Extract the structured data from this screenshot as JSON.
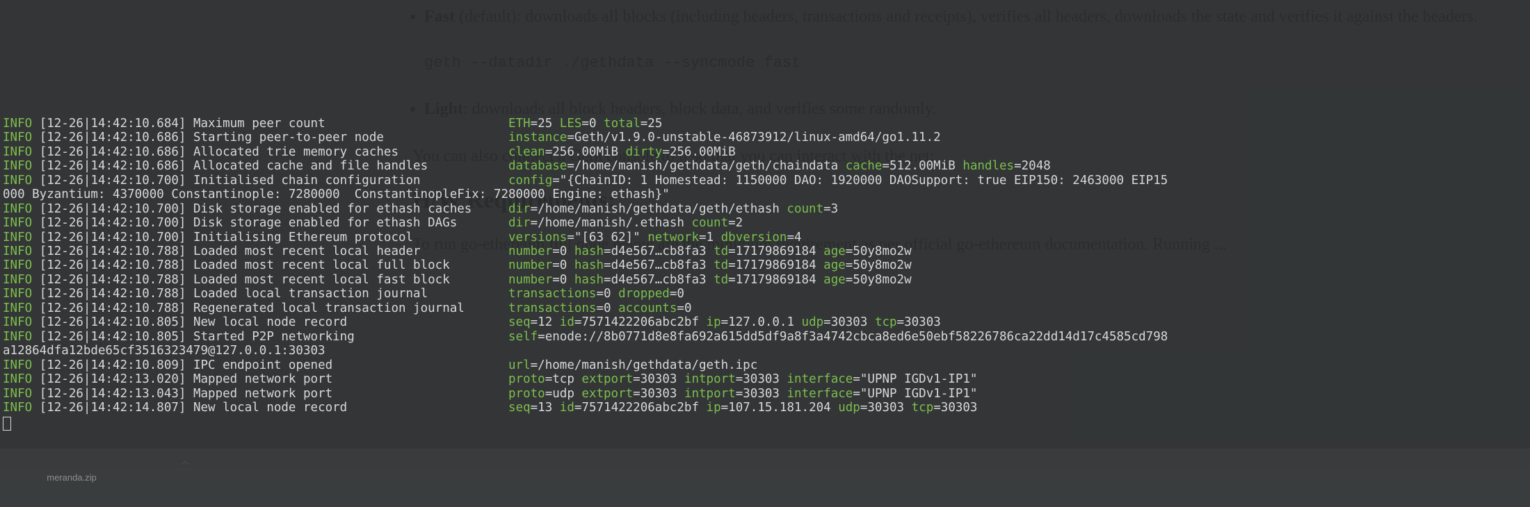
{
  "level": "INFO",
  "lines": [
    {
      "ts": "[12-26|14:42:10.684]",
      "msg": "Maximum peer count",
      "msg_pad": 43,
      "kv": [
        [
          "ETH",
          "25"
        ],
        [
          "LES",
          "0"
        ],
        [
          "total",
          "25"
        ]
      ]
    },
    {
      "ts": "[12-26|14:42:10.686]",
      "msg": "Starting peer-to-peer node",
      "msg_pad": 43,
      "kv": [
        [
          "instance",
          "Geth/v1.9.0-unstable-46873912/linux-amd64/go1.11.2"
        ]
      ]
    },
    {
      "ts": "[12-26|14:42:10.686]",
      "msg": "Allocated trie memory caches",
      "msg_pad": 43,
      "kv": [
        [
          "clean",
          "256.00MiB"
        ],
        [
          "dirty",
          "256.00MiB"
        ]
      ]
    },
    {
      "ts": "[12-26|14:42:10.686]",
      "msg": "Allocated cache and file handles",
      "msg_pad": 43,
      "kv": [
        [
          "database",
          "/home/manish/gethdata/geth/chaindata"
        ],
        [
          "cache",
          "512.00MiB"
        ],
        [
          "handles",
          "2048"
        ]
      ]
    },
    {
      "ts": "[12-26|14:42:10.700]",
      "msg": "Initialised chain configuration",
      "msg_pad": 43,
      "kv": [
        [
          "config",
          "\"{ChainID: 1 Homestead: 1150000 DAO: 1920000 DAOSupport: true EIP150: 2463000 EIP15"
        ]
      ],
      "wrap": "000 Byzantium: 4370000 Constantinople: 7280000  ConstantinopleFix: 7280000 Engine: ethash}\""
    },
    {
      "ts": "[12-26|14:42:10.700]",
      "msg": "Disk storage enabled for ethash caches",
      "msg_pad": 43,
      "kv": [
        [
          "dir",
          "/home/manish/gethdata/geth/ethash"
        ],
        [
          "count",
          "3"
        ]
      ]
    },
    {
      "ts": "[12-26|14:42:10.700]",
      "msg": "Disk storage enabled for ethash DAGs",
      "msg_pad": 43,
      "kv": [
        [
          "dir",
          "/home/manish/.ethash"
        ],
        [
          "count",
          "2"
        ]
      ],
      "kv_pad": {
        "1": 37
      }
    },
    {
      "ts": "[12-26|14:42:10.700]",
      "msg": "Initialising Ethereum protocol",
      "msg_pad": 43,
      "kv": [
        [
          "versions",
          "\"[63 62]\""
        ],
        [
          "network",
          "1"
        ],
        [
          "dbversion",
          "4"
        ]
      ]
    },
    {
      "ts": "[12-26|14:42:10.788]",
      "msg": "Loaded most recent local header",
      "msg_pad": 43,
      "kv": [
        [
          "number",
          "0"
        ],
        [
          "hash",
          "d4e567…cb8fa3"
        ],
        [
          "td",
          "17179869184"
        ],
        [
          "age",
          "50y8mo2w"
        ]
      ]
    },
    {
      "ts": "[12-26|14:42:10.788]",
      "msg": "Loaded most recent local full block",
      "msg_pad": 43,
      "kv": [
        [
          "number",
          "0"
        ],
        [
          "hash",
          "d4e567…cb8fa3"
        ],
        [
          "td",
          "17179869184"
        ],
        [
          "age",
          "50y8mo2w"
        ]
      ]
    },
    {
      "ts": "[12-26|14:42:10.788]",
      "msg": "Loaded most recent local fast block",
      "msg_pad": 43,
      "kv": [
        [
          "number",
          "0"
        ],
        [
          "hash",
          "d4e567…cb8fa3"
        ],
        [
          "td",
          "17179869184"
        ],
        [
          "age",
          "50y8mo2w"
        ]
      ]
    },
    {
      "ts": "[12-26|14:42:10.788]",
      "msg": "Loaded local transaction journal",
      "msg_pad": 43,
      "kv": [
        [
          "transactions",
          "0"
        ],
        [
          "dropped",
          "0"
        ]
      ]
    },
    {
      "ts": "[12-26|14:42:10.788]",
      "msg": "Regenerated local transaction journal",
      "msg_pad": 43,
      "kv": [
        [
          "transactions",
          "0"
        ],
        [
          "accounts",
          "0"
        ]
      ]
    },
    {
      "ts": "[12-26|14:42:10.805]",
      "msg": "New local node record",
      "msg_pad": 43,
      "kv": [
        [
          "seq",
          "12"
        ],
        [
          "id",
          "7571422206abc2bf"
        ],
        [
          "ip",
          "127.0.0.1"
        ],
        [
          "udp",
          "30303"
        ],
        [
          "tcp",
          "30303"
        ]
      ]
    },
    {
      "ts": "[12-26|14:42:10.805]",
      "msg": "Started P2P networking",
      "msg_pad": 43,
      "kv": [
        [
          "self",
          "enode://8b0771d8e8fa692a615dd5df9a8f3a4742cbca8ed6e50ebf58226786ca22dd14d17c4585cd798"
        ]
      ],
      "wrap": "a12864dfa12bde65cf3516323479@127.0.0.1:30303"
    },
    {
      "ts": "[12-26|14:42:10.809]",
      "msg": "IPC endpoint opened",
      "msg_pad": 43,
      "kv": [
        [
          "url",
          "/home/manish/gethdata/geth.ipc"
        ]
      ]
    },
    {
      "ts": "[12-26|14:42:13.020]",
      "msg": "Mapped network port",
      "msg_pad": 43,
      "kv": [
        [
          "proto",
          "tcp"
        ],
        [
          "extport",
          "30303"
        ],
        [
          "intport",
          "30303"
        ],
        [
          "interface",
          "\"UPNP IGDv1-IP1\""
        ]
      ]
    },
    {
      "ts": "[12-26|14:42:13.043]",
      "msg": "Mapped network port",
      "msg_pad": 43,
      "kv": [
        [
          "proto",
          "udp"
        ],
        [
          "extport",
          "30303"
        ],
        [
          "intport",
          "30303"
        ],
        [
          "interface",
          "\"UPNP IGDv1-IP1\""
        ]
      ]
    },
    {
      "ts": "[12-26|14:42:14.807]",
      "msg": "New local node record",
      "msg_pad": 43,
      "kv": [
        [
          "seq",
          "13"
        ],
        [
          "id",
          "7571422206abc2bf"
        ],
        [
          "ip",
          "107.15.181.204"
        ],
        [
          "udp",
          "30303"
        ],
        [
          "tcp",
          "30303"
        ]
      ]
    }
  ],
  "ghost": {
    "bullet1_b": "Fast",
    "bullet1_rest": " (default): downloads all blocks (including headers, transactions and receipts), verifies all headers, downloads the state and verifies it against the headers.",
    "code1": "geth --datadir ./gethdata --syncmode fast",
    "bullet2_b": "Light",
    "bullet2_rest": ": downloads all block headers, block data, and verifies some randomly.",
    "p1": "You can also connect a Geth console to it so that you can interact with the net:",
    "h1": "H/W Requirements:",
    "p2": "To run go-ethereum full node below are the minimum requirement as per official go-ethereum documentation. Running ..."
  },
  "taskbar": {
    "file": "meranda.zip"
  }
}
